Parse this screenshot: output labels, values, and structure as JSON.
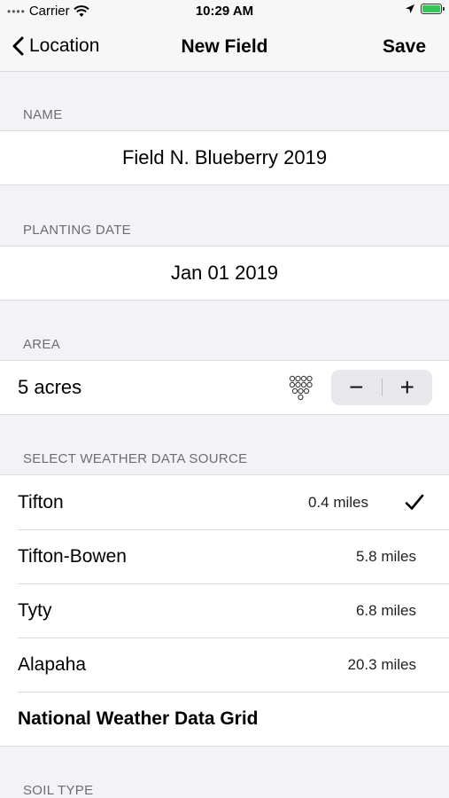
{
  "status_bar": {
    "carrier": "Carrier",
    "time": "10:29 AM"
  },
  "nav": {
    "back_label": "Location",
    "title": "New Field",
    "save_label": "Save"
  },
  "name_section": {
    "header": "NAME",
    "value": "Field N. Blueberry 2019"
  },
  "planting_section": {
    "header": "PLANTING DATE",
    "value": "Jan 01 2019"
  },
  "area_section": {
    "header": "AREA",
    "value": "5 acres",
    "minus_label": "−",
    "plus_label": "+"
  },
  "weather_section": {
    "header": "SELECT WEATHER DATA SOURCE",
    "stations": [
      {
        "name": "Tifton",
        "distance": "0.4 miles",
        "selected": true
      },
      {
        "name": "Tifton-Bowen",
        "distance": "5.8 miles",
        "selected": false
      },
      {
        "name": "Tyty",
        "distance": "6.8 miles",
        "selected": false
      },
      {
        "name": "Alapaha",
        "distance": "20.3 miles",
        "selected": false
      },
      {
        "name": "National Weather Data Grid",
        "distance": "",
        "selected": false
      }
    ]
  },
  "soil_section": {
    "header": "SOIL TYPE"
  },
  "colors": {
    "battery": "#34c759",
    "background": "#f2f2f7"
  }
}
